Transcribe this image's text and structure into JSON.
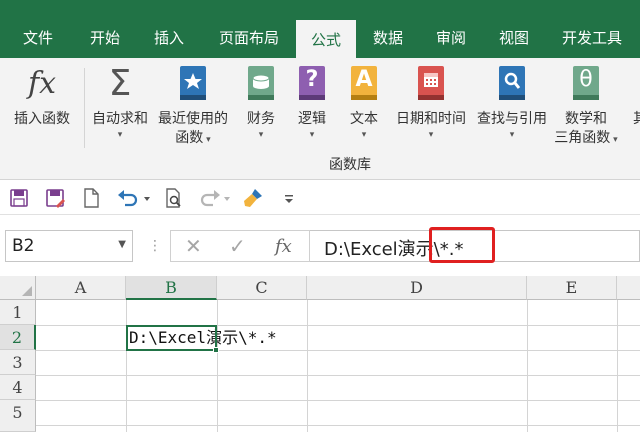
{
  "tabs": [
    {
      "label": "文件",
      "active": false
    },
    {
      "label": "开始",
      "active": false
    },
    {
      "label": "插入",
      "active": false
    },
    {
      "label": "页面布局",
      "active": false
    },
    {
      "label": "公式",
      "active": true
    },
    {
      "label": "数据",
      "active": false
    },
    {
      "label": "审阅",
      "active": false
    },
    {
      "label": "视图",
      "active": false
    },
    {
      "label": "开发工具",
      "active": false
    }
  ],
  "ribbon": {
    "insert_function": {
      "icon_glyph": "fx",
      "label": "插入函数"
    },
    "autosum": {
      "icon_glyph": "Σ",
      "label": "自动求和"
    },
    "recent": {
      "label1": "最近使用的",
      "label2": "函数"
    },
    "financial": {
      "label": "财务"
    },
    "logical": {
      "icon_glyph": "?",
      "label": "逻辑"
    },
    "text": {
      "icon_glyph": "A",
      "label": "文本"
    },
    "datetime": {
      "label": "日期和时间"
    },
    "lookup": {
      "label": "查找与引用"
    },
    "math": {
      "icon_glyph": "θ",
      "label1": "数学和",
      "label2": "三角函数"
    },
    "more": {
      "label": "其"
    },
    "group_label": "函数库"
  },
  "qat": {
    "icons": [
      "save-icon",
      "save-as-icon",
      "new-document-icon",
      "undo-icon",
      "print-preview-icon",
      "redo-icon",
      "format-painter-icon",
      "customize-icon"
    ]
  },
  "formula_bar": {
    "name_box": "B2",
    "cancel_glyph": "✕",
    "enter_glyph": "✓",
    "fx_glyph": "fx",
    "content": "D:\\Excel演示\\*.*",
    "dots_glyph": "⋮"
  },
  "grid": {
    "columns": [
      "A",
      "B",
      "C",
      "D",
      "E"
    ],
    "rows": [
      "1",
      "2",
      "3",
      "4",
      "5"
    ],
    "active_cell": "B2",
    "cells": {
      "B2": "D:\\Excel演示\\*.*"
    }
  },
  "colors": {
    "accent": "#217346",
    "highlight_box": "#e02020"
  }
}
